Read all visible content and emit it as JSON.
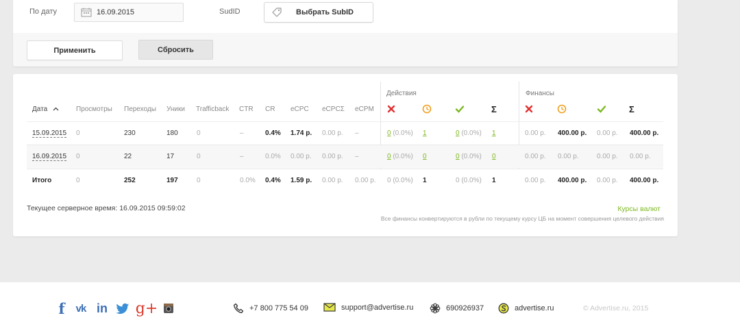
{
  "filters": {
    "date_label": "По дату",
    "date_value": "16.09.2015",
    "subid_label": "SudID",
    "subid_button": "Выбрать SubID",
    "apply_button": "Применить",
    "reset_button": "Сбросить"
  },
  "stats": {
    "group_actions": "Действия",
    "group_finance": "Финансы",
    "headers": {
      "date": "Дата",
      "views": "Просмотры",
      "clicks": "Переходы",
      "uniques": "Уники",
      "trafficback": "Trafficback",
      "ctr": "CTR",
      "cr": "CR",
      "ecpc": "eCPC",
      "ecpc_sum": "eCPCΣ",
      "ecpm": "eCPM",
      "sigma": "Σ"
    },
    "rows": [
      {
        "date": "15.09.2015",
        "views": "0",
        "clicks": "230",
        "uniques": "180",
        "tb": "0",
        "ctr": "–",
        "cr": "0.4%",
        "ecpc": "1.74 р.",
        "ecpc_sum": "0.00 р.",
        "ecpm": "–",
        "a_rej": "0",
        "a_rej_pct": "(0.0%)",
        "a_hold": "1",
        "a_ok": "0",
        "a_ok_pct": "(0.0%)",
        "a_sum": "1",
        "f_rej": "0.00 р.",
        "f_hold": "400.00 р.",
        "f_ok": "0.00 р.",
        "f_sum": "400.00 р."
      },
      {
        "date": "16.09.2015",
        "views": "0",
        "clicks": "22",
        "uniques": "17",
        "tb": "0",
        "ctr": "–",
        "cr": "0.0%",
        "ecpc": "0.00 р.",
        "ecpc_sum": "0.00 р.",
        "ecpm": "–",
        "a_rej": "0",
        "a_rej_pct": "(0.0%)",
        "a_hold": "0",
        "a_ok": "0",
        "a_ok_pct": "(0.0%)",
        "a_sum": "0",
        "f_rej": "0.00 р.",
        "f_hold": "0.00 р.",
        "f_ok": "0.00 р.",
        "f_sum": "0.00 р."
      }
    ],
    "total": {
      "label": "Итого",
      "views": "0",
      "clicks": "252",
      "uniques": "197",
      "tb": "0",
      "ctr": "0.0%",
      "cr": "0.4%",
      "ecpc": "1.59 р.",
      "ecpc_sum": "0.00 р.",
      "ecpm": "0.00 р.",
      "a_rej": "0 (0.0%)",
      "a_hold": "1",
      "a_ok": "0 (0.0%)",
      "a_sum": "1",
      "f_rej": "0.00 р.",
      "f_hold": "400.00 р.",
      "f_ok": "0.00 р.",
      "f_sum": "400.00 р."
    },
    "server_time": "Текущее серверное время: 16.09.2015 09:59:02",
    "fx_link": "Курсы валют",
    "fx_note": "Все финансы конвертируются в рубли по текущему курсу ЦБ на момент совершения целевого действия"
  },
  "footer": {
    "social": [
      "facebook-icon",
      "vk-icon",
      "linkedin-icon",
      "twitter-icon",
      "google-plus-icon",
      "instagram-icon"
    ],
    "social_glyphs": {
      "facebook": "f",
      "vk": "vk",
      "linkedin": "in",
      "google_plus": "g+"
    },
    "phone": "+7 800 775 54 09",
    "email": "support@advertise.ru",
    "icq": "690926937",
    "skype": "advertise.ru",
    "copyright": "© Advertise.ru, 2015"
  },
  "colors": {
    "accent_green": "#7cb820",
    "reject_red": "#e03030",
    "hold_orange": "#f0a020",
    "social_blue": "#3b6fb6",
    "google_red": "#d9392b"
  }
}
